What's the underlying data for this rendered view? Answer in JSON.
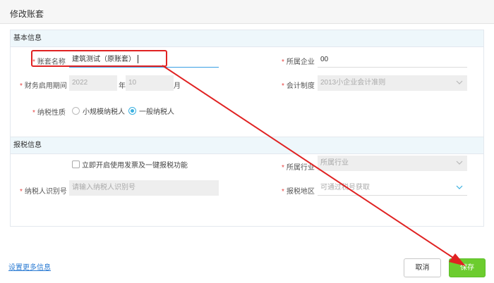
{
  "dialog": {
    "title": "修改账套"
  },
  "basic": {
    "section_title": "基本信息",
    "account_name": {
      "label": "账套名称",
      "value": "建筑测试（原账套）"
    },
    "company": {
      "label": "所属企业",
      "value": "00"
    },
    "period": {
      "label": "财务启用期间",
      "year": "2022",
      "year_unit": "年",
      "month": "10",
      "month_unit": "月"
    },
    "accounting_system": {
      "label": "会计制度",
      "value": "2013小企业会计准则"
    },
    "taxpayer_type": {
      "label": "纳税性质",
      "options": [
        {
          "label": "小规模纳税人",
          "selected": false
        },
        {
          "label": "一般纳税人",
          "selected": true
        }
      ]
    }
  },
  "tax": {
    "section_title": "报税信息",
    "enable_invoice_label": "立即开启使用发票及一键报税功能",
    "industry": {
      "label": "所属行业",
      "placeholder": "所属行业"
    },
    "taxpayer_id": {
      "label": "纳税人识别号",
      "placeholder": "请输入纳税人识别号"
    },
    "region": {
      "label": "报税地区",
      "placeholder": "可通过税号获取"
    }
  },
  "footer": {
    "more_link": "设置更多信息",
    "cancel_label": "取消",
    "save_label": "保存"
  },
  "colors": {
    "accent": "#3ab0e0",
    "save": "#6ccc2e",
    "annotation": "#e02222",
    "required": "#e64340"
  }
}
